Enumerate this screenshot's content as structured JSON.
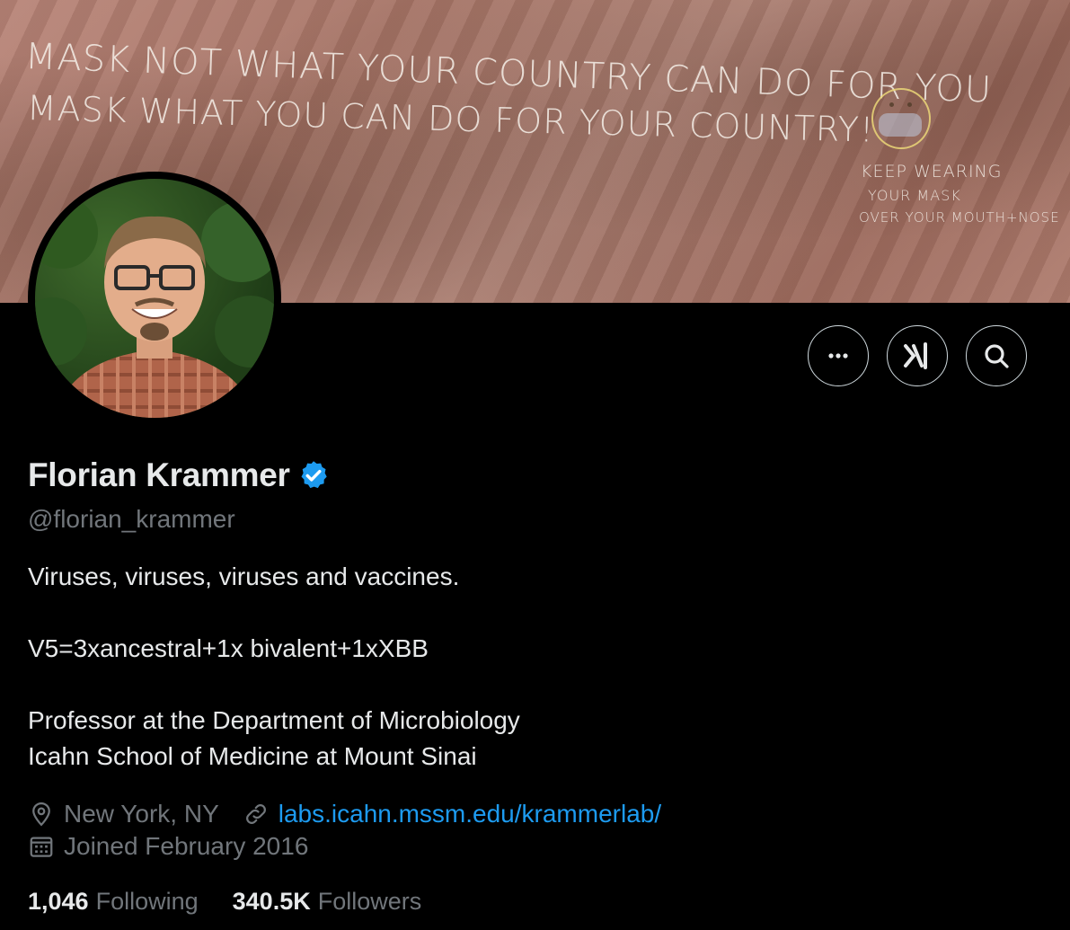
{
  "banner": {
    "line1": "MASK NOT WHAT YOUR COUNTRY CAN DO FOR YOU",
    "line2": "MASK WHAT YOU CAN DO FOR YOUR COUNTRY!",
    "side1": "KEEP WEARING",
    "side2": "YOUR MASK",
    "side3": "OVER YOUR MOUTH+NOSE"
  },
  "actions": {
    "more_icon": "more-icon",
    "grok_icon": "grok-icon",
    "search_icon": "search-icon"
  },
  "profile": {
    "display_name": "Florian Krammer",
    "handle": "@florian_krammer",
    "verified_color": "#1d9bf0",
    "bio_lines": [
      "Viruses, viruses, viruses and vaccines.",
      "V5=3xancestral+1x bivalent+1xXBB",
      "Professor at the Department of Microbiology",
      "Icahn School of Medicine at Mount Sinai"
    ],
    "location": "New York, NY",
    "website": "labs.icahn.mssm.edu/krammerlab/",
    "joined": "Joined February 2016"
  },
  "stats": {
    "following_count": "1,046",
    "following_label": "Following",
    "followers_count": "340.5K",
    "followers_label": "Followers"
  },
  "colors": {
    "background": "#000000",
    "text": "#e7e9ea",
    "muted": "#71767b",
    "accent": "#1d9bf0"
  }
}
